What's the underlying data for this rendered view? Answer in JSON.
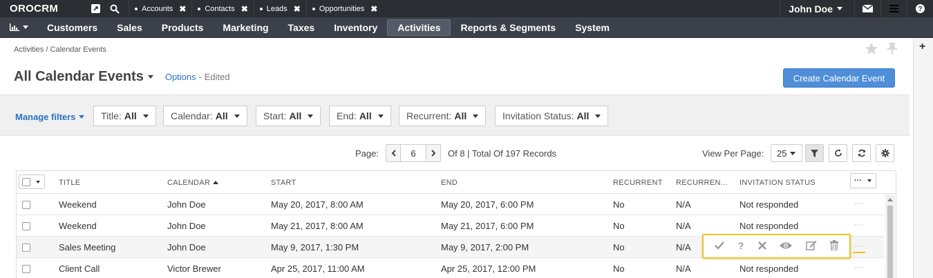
{
  "app": {
    "logo": "OROCRM"
  },
  "topbar": {
    "pinned_tabs": [
      {
        "label": "Accounts"
      },
      {
        "label": "Contacts"
      },
      {
        "label": "Leads"
      },
      {
        "label": "Opportunities"
      }
    ],
    "user_name": "John Doe"
  },
  "mainnav": {
    "items": [
      {
        "label": "Customers"
      },
      {
        "label": "Sales"
      },
      {
        "label": "Products"
      },
      {
        "label": "Marketing"
      },
      {
        "label": "Taxes"
      },
      {
        "label": "Inventory"
      },
      {
        "label": "Activities",
        "active": true
      },
      {
        "label": "Reports & Segments"
      },
      {
        "label": "System"
      }
    ]
  },
  "breadcrumb": "Activities / Calendar Events",
  "page": {
    "title": "All Calendar Events",
    "options_label": "Options",
    "edited_label": "- Edited",
    "create_button": "Create Calendar Event"
  },
  "filters": {
    "manage_label": "Manage filters",
    "items": [
      {
        "name": "Title:",
        "value": "All"
      },
      {
        "name": "Calendar:",
        "value": "All"
      },
      {
        "name": "Start:",
        "value": "All"
      },
      {
        "name": "End:",
        "value": "All"
      },
      {
        "name": "Recurrent:",
        "value": "All"
      },
      {
        "name": "Invitation Status:",
        "value": "All"
      }
    ]
  },
  "pagination": {
    "page_label": "Page:",
    "current_page": "6",
    "records_text": "Of 8 | Total Of 197 Records",
    "view_per_page_label": "View Per Page:",
    "per_page": "25"
  },
  "grid": {
    "columns": [
      "Title",
      "Calendar",
      "Start",
      "End",
      "Recurrent",
      "Recurren...",
      "Invitation Status"
    ],
    "rows": [
      {
        "title": "Weekend",
        "calendar": "John Doe",
        "start": "May 20, 2017, 8:00 AM",
        "end": "May 20, 2017, 6:00 PM",
        "recurrent": "No",
        "recurrence": "N/A",
        "invitation": "Not responded"
      },
      {
        "title": "Weekend",
        "calendar": "John Doe",
        "start": "May 21, 2017, 8:00 AM",
        "end": "May 21, 2017, 6:00 PM",
        "recurrent": "No",
        "recurrence": "N/A",
        "invitation": "Not responded"
      },
      {
        "title": "Sales Meeting",
        "calendar": "John Doe",
        "start": "May 9, 2017, 1:30 PM",
        "end": "May 9, 2017, 2:00 PM",
        "recurrent": "No",
        "recurrence": "N/A",
        "invitation": ""
      },
      {
        "title": "Client Call",
        "calendar": "Victor Brewer",
        "start": "Apr 25, 2017, 11:00 AM",
        "end": "Apr 25, 2017, 12:00 PM",
        "recurrent": "No",
        "recurrence": "N/A",
        "invitation": "Not responded"
      }
    ],
    "row_dots": "···",
    "head_actions_label": "···"
  },
  "row_actions": [
    "check-icon",
    "question-icon",
    "close-icon",
    "eye-icon",
    "edit-icon",
    "trash-icon"
  ],
  "colors": {
    "topbar": "#2b2e33",
    "mainnav": "#3b404a",
    "accent": "#4f8ed8",
    "link": "#2a70c4",
    "highlight": "#f0c419"
  }
}
